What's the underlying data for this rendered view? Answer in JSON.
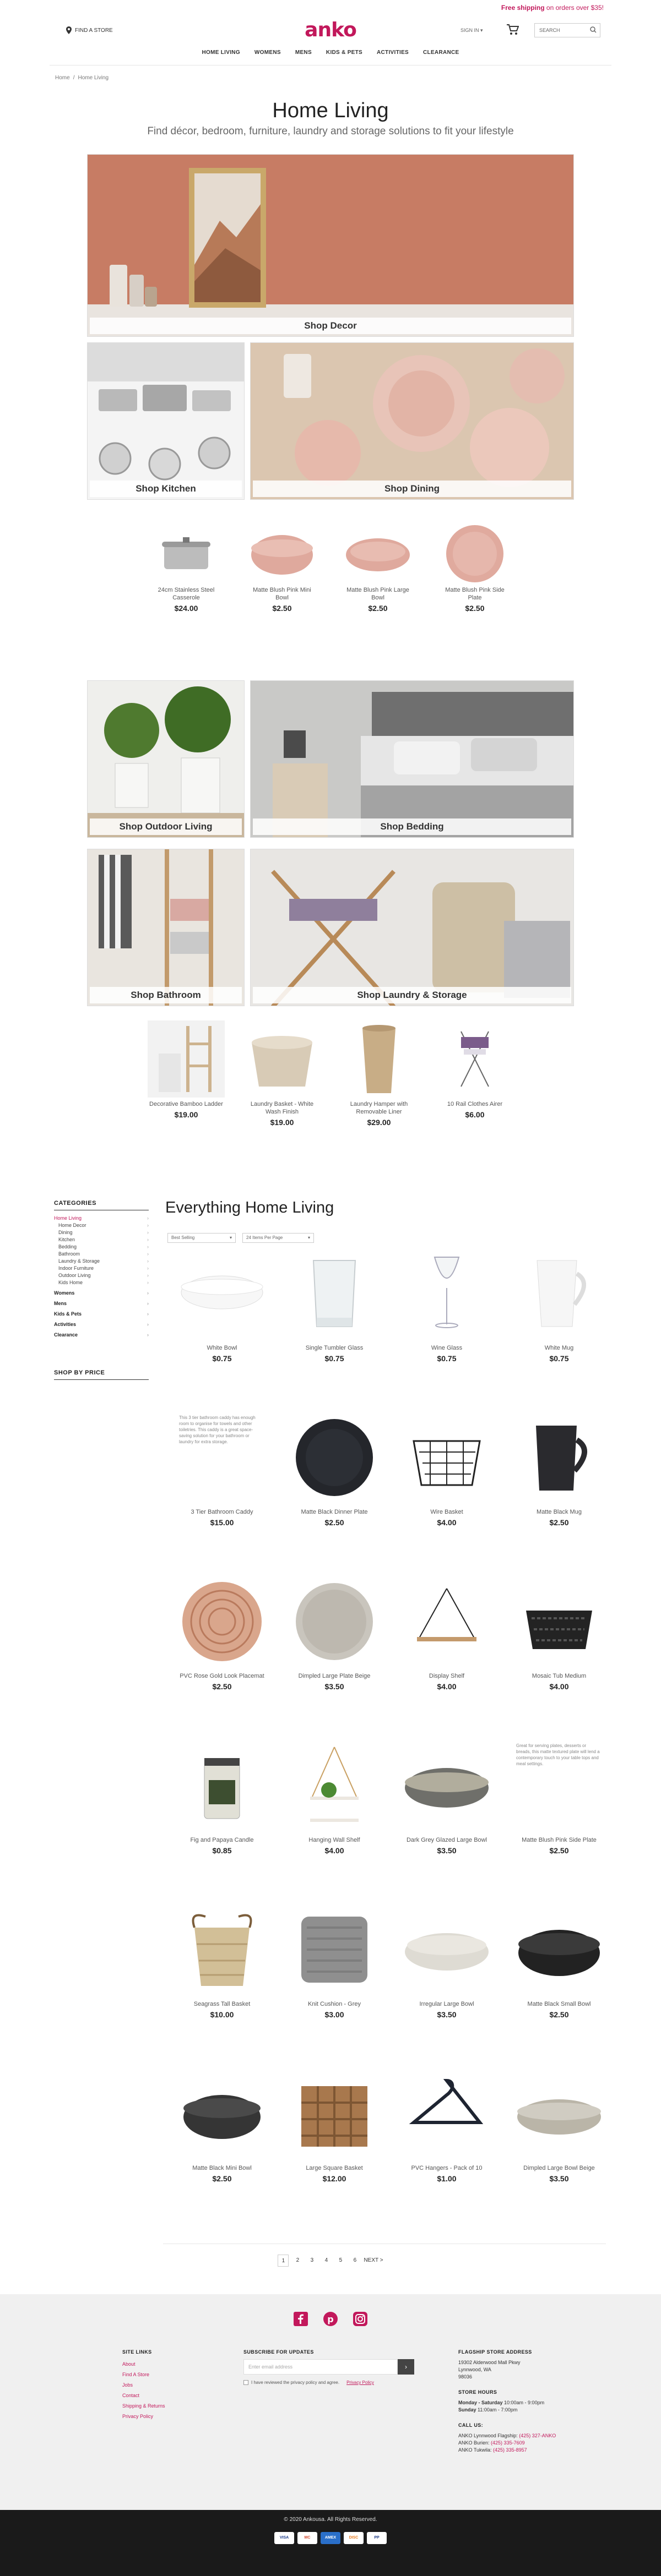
{
  "promo": {
    "bold": "Free shipping",
    "rest": " on orders over $35!"
  },
  "header": {
    "find_store": "FIND A STORE",
    "logo": "anko",
    "sign_in": "SIGN IN",
    "search_placeholder": "SEARCH"
  },
  "nav": [
    "HOME LIVING",
    "WOMENS",
    "MENS",
    "KIDS & PETS",
    "ACTIVITIES",
    "CLEARANCE"
  ],
  "breadcrumb": [
    "Home",
    "Home Living"
  ],
  "hero": {
    "title": "Home Living",
    "subtitle": "Find décor, bedroom, furniture, laundry and storage solutions to fit your lifestyle"
  },
  "tiles": [
    "Shop Decor",
    "Shop Kitchen",
    "Shop Dining",
    "Shop Outdoor Living",
    "Shop Bedding",
    "Shop Bathroom",
    "Shop Laundry & Storage"
  ],
  "featured1": [
    {
      "name": "24cm Stainless Steel Casserole",
      "price": "$24.00"
    },
    {
      "name": "Matte Blush Pink Mini Bowl",
      "price": "$2.50"
    },
    {
      "name": "Matte Blush Pink Large Bowl",
      "price": "$2.50"
    },
    {
      "name": "Matte Blush Pink Side Plate",
      "price": "$2.50"
    }
  ],
  "featured2": [
    {
      "name": "Decorative Bamboo Ladder",
      "price": "$19.00"
    },
    {
      "name": "Laundry Basket - White Wash Finish",
      "price": "$19.00"
    },
    {
      "name": "Laundry Hamper with Removable Liner",
      "price": "$29.00"
    },
    {
      "name": "10 Rail Clothes Airer",
      "price": "$6.00"
    }
  ],
  "sidebar": {
    "title": "CATEGORIES",
    "items": [
      {
        "label": "Home Living",
        "type": "act"
      },
      {
        "label": "Home Decor",
        "type": "sub2"
      },
      {
        "label": "Dining",
        "type": "sub2"
      },
      {
        "label": "Kitchen",
        "type": "sub2"
      },
      {
        "label": "Bedding",
        "type": "sub2"
      },
      {
        "label": "Bathroom",
        "type": "sub2"
      },
      {
        "label": "Laundry & Storage",
        "type": "sub2"
      },
      {
        "label": "Indoor Furniture",
        "type": "sub2"
      },
      {
        "label": "Outdoor Living",
        "type": "sub2"
      },
      {
        "label": "Kids Home",
        "type": "sub2"
      },
      {
        "label": "Womens",
        "type": "top"
      },
      {
        "label": "Mens",
        "type": "top"
      },
      {
        "label": "Kids & Pets",
        "type": "top"
      },
      {
        "label": "Activities",
        "type": "top"
      },
      {
        "label": "Clearance",
        "type": "top"
      }
    ],
    "price_title": "SHOP BY PRICE"
  },
  "everything": {
    "title": "Everything Home Living",
    "sort": "Best Selling",
    "per_page": "24 Items Per Page"
  },
  "products": [
    {
      "name": "White Bowl",
      "price": "$0.75",
      "img": "bowl-white"
    },
    {
      "name": "Single Tumbler Glass",
      "price": "$0.75",
      "img": "glass"
    },
    {
      "name": "Wine Glass",
      "price": "$0.75",
      "img": "wineglass"
    },
    {
      "name": "White Mug",
      "price": "$0.75",
      "img": "mug-white"
    },
    {
      "name": "3 Tier Bathroom Caddy",
      "price": "$15.00",
      "img": "alt",
      "alt": "This 3 tier bathroom caddy has enough room to organise for towels and other toiletries. This caddy is a great space-saving solution for your bathroom or laundry for extra storage."
    },
    {
      "name": "Matte Black Dinner Plate",
      "price": "$2.50",
      "img": "plate-black"
    },
    {
      "name": "Wire Basket",
      "price": "$4.00",
      "img": "wirebasket"
    },
    {
      "name": "Matte Black Mug",
      "price": "$2.50",
      "img": "mug-black"
    },
    {
      "name": "PVC Rose Gold Look Placemat",
      "price": "$2.50",
      "img": "placemat"
    },
    {
      "name": "Dimpled Large Plate Beige",
      "price": "$3.50",
      "img": "plate-beige"
    },
    {
      "name": "Display Shelf",
      "price": "$4.00",
      "img": "shelf"
    },
    {
      "name": "Mosaic Tub Medium",
      "price": "$4.00",
      "img": "tub"
    },
    {
      "name": "Fig and Papaya Candle",
      "price": "$0.85",
      "img": "candle"
    },
    {
      "name": "Hanging Wall Shelf",
      "price": "$4.00",
      "img": "hangshelf"
    },
    {
      "name": "Dark Grey Glazed Large Bowl",
      "price": "$3.50",
      "img": "bowl-grey"
    },
    {
      "name": "Matte Blush Pink Side Plate",
      "price": "$2.50",
      "img": "alt",
      "alt": "Great for serving plates, desserts or breads, this matte textured plate will lend a contemporary touch to your table tops and meal settings."
    },
    {
      "name": "Seagrass Tall Basket",
      "price": "$10.00",
      "img": "basket"
    },
    {
      "name": "Knit Cushion - Grey",
      "price": "$3.00",
      "img": "cushion"
    },
    {
      "name": "Irregular Large Bowl",
      "price": "$3.50",
      "img": "bowl-irr"
    },
    {
      "name": "Matte Black Small Bowl",
      "price": "$2.50",
      "img": "bowl-black"
    },
    {
      "name": "Matte Black Mini Bowl",
      "price": "$2.50",
      "img": "bowl-black2"
    },
    {
      "name": "Large Square Basket",
      "price": "$12.00",
      "img": "sqbasket"
    },
    {
      "name": "PVC Hangers - Pack of 10",
      "price": "$1.00",
      "img": "hanger"
    },
    {
      "name": "Dimpled Large Bowl Beige",
      "price": "$3.50",
      "img": "bowl-beige"
    }
  ],
  "pagination": [
    "1",
    "2",
    "3",
    "4",
    "5",
    "6",
    "NEXT >"
  ],
  "footer": {
    "site_links_title": "SITE LINKS",
    "site_links": [
      "About",
      "Find A Store",
      "Jobs",
      "Contact",
      "Shipping & Returns",
      "Privacy Policy"
    ],
    "subscribe_title": "SUBSCRIBE FOR UPDATES",
    "email_placeholder": "Enter email address",
    "consent": "I have reviewed the privacy policy and agree.",
    "consent_link": "Privacy Policy",
    "store_title": "FLAGSHIP STORE ADDRESS",
    "store_lines": [
      "19302 Alderwood Mall Pkwy",
      "Lynnwood, WA",
      "98036"
    ],
    "hours_title": "STORE HOURS",
    "hours": [
      {
        "day": "Monday - Saturday",
        "time": "10:00am - 9:00pm"
      },
      {
        "day": "Sunday",
        "time": "11:00am - 7:00pm"
      }
    ],
    "call_title": "CALL US:",
    "calls": [
      {
        "label": "ANKO Lynnwood Flagship:",
        "phone": "(425) 327-ANKO"
      },
      {
        "label": "ANKO Burien:",
        "phone": "(425) 335-7609"
      },
      {
        "label": "ANKO Tukwila:",
        "phone": "(425) 335-8957"
      }
    ]
  },
  "copyright": "© 2020 Ankousa. All Rights Reserved.",
  "payment": [
    "VISA",
    "MC",
    "AMEX",
    "DISC",
    "PP"
  ],
  "colors": {
    "brand": "#c2185b"
  }
}
